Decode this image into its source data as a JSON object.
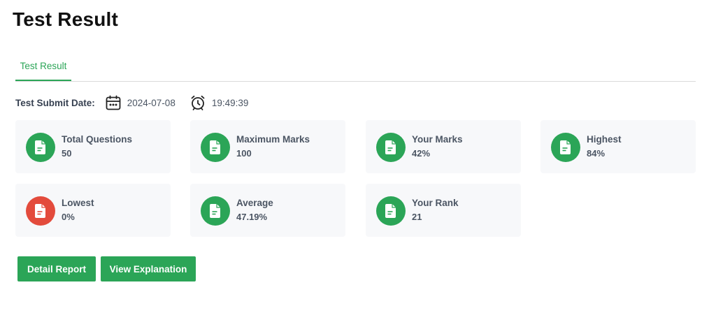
{
  "page": {
    "title": "Test Result"
  },
  "tabs": [
    {
      "label": "Test Result"
    }
  ],
  "meta": {
    "submit_label": "Test Submit Date:",
    "date": "2024-07-08",
    "time": "19:49:39"
  },
  "stats": [
    {
      "title": "Total Questions",
      "value": "50",
      "icon": "document-icon",
      "color": "#2ba557"
    },
    {
      "title": "Maximum Marks",
      "value": "100",
      "icon": "document-icon",
      "color": "#2ba557"
    },
    {
      "title": "Your Marks",
      "value": "42%",
      "icon": "document-icon",
      "color": "#2ba557"
    },
    {
      "title": "Highest",
      "value": "84%",
      "icon": "document-icon",
      "color": "#2ba557"
    },
    {
      "title": "Lowest",
      "value": "0%",
      "icon": "document-icon",
      "color": "#e34b3c"
    },
    {
      "title": "Average",
      "value": "47.19%",
      "icon": "document-icon",
      "color": "#2ba557"
    },
    {
      "title": "Your Rank",
      "value": "21",
      "icon": "document-icon",
      "color": "#2ba557"
    }
  ],
  "actions": {
    "detail_report": "Detail Report",
    "view_explanation": "View Explanation"
  },
  "colors": {
    "accent": "#2ba557",
    "danger": "#e34b3c",
    "card_bg": "#f7f8fa"
  }
}
